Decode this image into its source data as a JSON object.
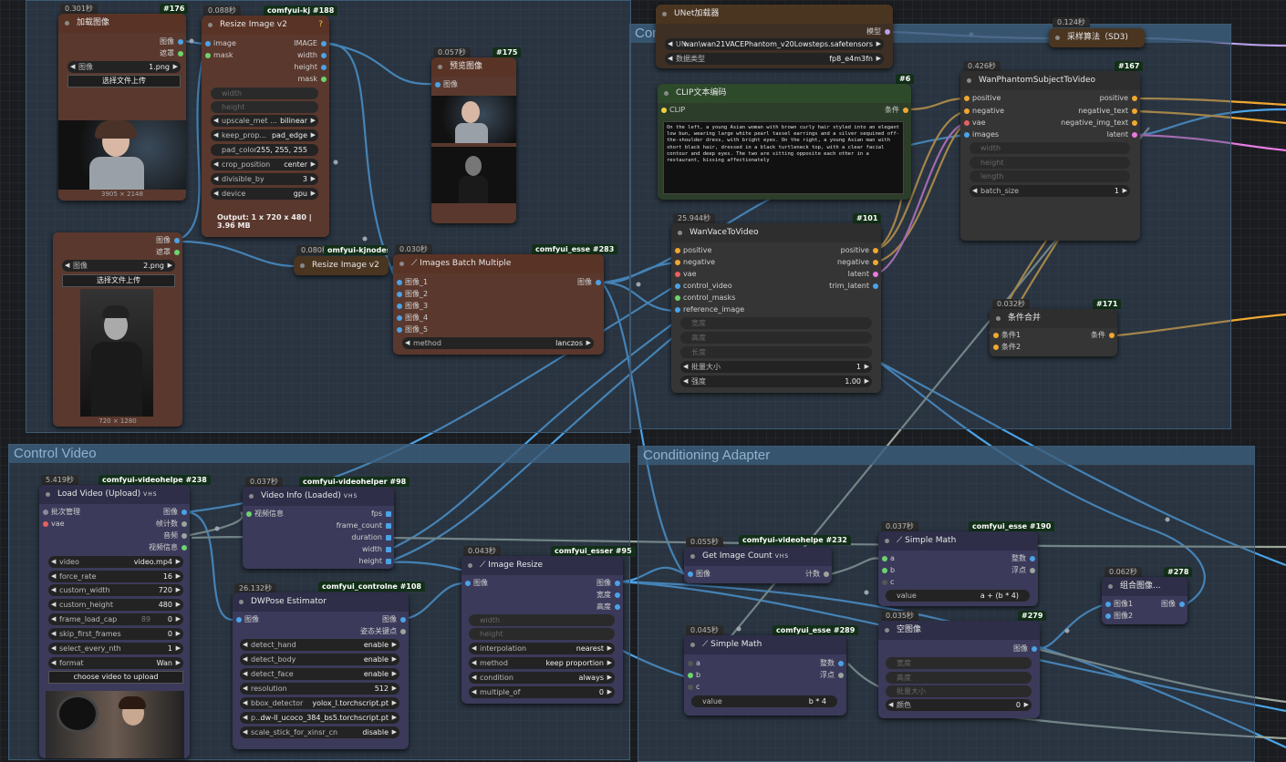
{
  "colors": {
    "link_blue": "#4aa3e8",
    "link_orange": "#f0a830",
    "link_gray": "#9aa69a",
    "link_pink": "#e87ae0",
    "link_lilac": "#b8a0e8",
    "link_red": "#e86060"
  },
  "groups": {
    "top": "Con",
    "control_video": "Control Video",
    "conditioning_adapter": "Conditioning Adapter"
  },
  "n176": {
    "time": "0.301秒",
    "id": "#176",
    "title": "加载图像",
    "out1": "图像",
    "out2": "遮罩",
    "image_label": "图像",
    "image_value": "1.png",
    "upload": "选择文件上传",
    "dims": "3905 × 2148"
  },
  "n188": {
    "time": "0.088秒",
    "badge": "comfyui-kj",
    "id": "#188",
    "title": "Resize Image v2",
    "in1": "image",
    "in2": "mask",
    "out1": "IMAGE",
    "out2": "width",
    "out3": "height",
    "out4": "mask",
    "w_width": "width",
    "w_height": "height",
    "upscale_label": "upscale_met ...",
    "upscale_value": "bilinear",
    "keep_label": "keep_prop...",
    "keep_value": "pad_edge",
    "pad_label": "pad_color",
    "pad_value": "255, 255, 255",
    "crop_label": "crop_position",
    "crop_value": "center",
    "div_label": "divisible_by",
    "div_value": "3",
    "device_label": "device",
    "device_value": "gpu",
    "output": "Output: 1 x 720 x 480 | 3.96 MB"
  },
  "n175": {
    "time": "0.057秒",
    "id": "#175",
    "title": "预览图像",
    "in1": "图像"
  },
  "nload2": {
    "out1": "图像",
    "out2": "遮罩",
    "image_label": "图像",
    "image_value": "2.png",
    "upload": "选择文件上传",
    "dims": "720 × 1280"
  },
  "nresize2": {
    "time": "0.080秒",
    "badge": "omfyui-kjnodes",
    "title": "Resize Image v2"
  },
  "n283": {
    "time": "0.030秒",
    "badge": "comfyui_esse",
    "id": "#283",
    "title": "Images Batch Multiple",
    "in1": "图像_1",
    "in2": "图像_2",
    "in3": "图像_3",
    "in4": "图像_4",
    "in5": "图像_5",
    "out1": "图像",
    "method_label": "method",
    "method_value": "lanczos"
  },
  "nunet": {
    "title": "UNet加载器",
    "out1": "模型",
    "unet_label": "UN...",
    "unet_value": "wan\\wan21VACEPhantom_v20Lowsteps.safetensors",
    "dtype_label": "数据类型",
    "dtype_value": "fp8_e4m3fn"
  },
  "nclip": {
    "id": "#6",
    "title": "CLIP文本编码",
    "in1": "CLIP",
    "out1": "条件",
    "text": "On the left, a young Asian woman with brown curly hair styled into an elegant low bun, wearing large white pearl tassel earrings and a silver sequined off-the-shoulder dress, with bright eyes. On the right, a young Asian man with short black hair, dressed in a black turtleneck top, with a clear facial contour and deep eyes. The two are sitting opposite each other in a restaurant, kissing affectionately"
  },
  "nsampler": {
    "time": "0.124秒",
    "title": "采样算法（SD3)"
  },
  "n167": {
    "time": "0.426秒",
    "id": "#167",
    "title": "WanPhantomSubjectToVideo",
    "in1": "positive",
    "in2": "negative",
    "in3": "vae",
    "in4": "images",
    "out1": "positive",
    "out2": "negative_text",
    "out3": "negative_img_text",
    "out4": "latent",
    "w1": "width",
    "w2": "height",
    "w3": "length",
    "batch_label": "batch_size",
    "batch_value": "1"
  },
  "n101": {
    "time": "25.944秒",
    "id": "#101",
    "title": "WanVaceToVideo",
    "in1": "positive",
    "in2": "negative",
    "in3": "vae",
    "in4": "control_video",
    "in5": "control_masks",
    "in6": "reference_image",
    "out1": "positive",
    "out2": "negative",
    "out3": "latent",
    "out4": "trim_latent",
    "w1": "宽度",
    "w2": "高度",
    "w3": "长度",
    "batch_label": "批量大小",
    "batch_value": "1",
    "strength_label": "强度",
    "strength_value": "1.00"
  },
  "n171": {
    "time": "0.032秒",
    "id": "#171",
    "title": "条件合并",
    "in1": "条件1",
    "in2": "条件2",
    "out1": "条件"
  },
  "n238": {
    "time": "5.419秒",
    "badge": "comfyui-videohelpe",
    "id": "#238",
    "title": "Load Video (Upload)",
    "vhs": "VHS",
    "in1": "批次管理",
    "in2": "vae",
    "out1": "图像",
    "out2": "帧计数",
    "out3": "音频",
    "out4": "视频信息",
    "video_label": "video",
    "video_value": "video.mp4",
    "force_rate_label": "force_rate",
    "force_rate_value": "16",
    "cw_label": "custom_width",
    "cw_value": "720",
    "ch_label": "custom_height",
    "ch_value": "480",
    "flc_label": "frame_load_cap",
    "flc_value": "0",
    "flc_hint": "89",
    "skip_label": "skip_first_frames",
    "skip_value": "0",
    "sel_label": "select_every_nth",
    "sel_value": "1",
    "format_label": "format",
    "format_value": "Wan",
    "upload": "choose video to upload"
  },
  "n98": {
    "time": "0.037秒",
    "badge": "comfyui-videohelper",
    "id": "#98",
    "title": "Video Info (Loaded)",
    "vhs": "VHS",
    "in1": "视频信息",
    "out1": "fps",
    "out2": "frame_count",
    "out3": "duration",
    "out4": "width",
    "out5": "height"
  },
  "n108": {
    "time": "26.132秒",
    "badge": "comfyui_controlne",
    "id": "#108",
    "title": "DWPose Estimator",
    "in1": "图像",
    "out1": "图像",
    "out2": "姿态关键点",
    "hand_label": "detect_hand",
    "hand_value": "enable",
    "body_label": "detect_body",
    "body_value": "enable",
    "face_label": "detect_face",
    "face_value": "enable",
    "res_label": "resolution",
    "res_value": "512",
    "bbox_label": "bbox_detector",
    "bbox_value": "yolox_l.torchscript.pt",
    "pose_label": "p...",
    "pose_value": "dw-ll_ucoco_384_bs5.torchscript.pt",
    "scale_label": "scale_stick_for_xinsr_cn",
    "scale_value": "disable"
  },
  "n95": {
    "time": "0.043秒",
    "badge": "comfyui_esser",
    "id": "#95",
    "title": "Image Resize",
    "in1": "图像",
    "out1": "图像",
    "out2": "宽度",
    "out3": "高度",
    "w1": "width",
    "w2": "height",
    "interp_label": "interpolation",
    "interp_value": "nearest",
    "method_label": "method",
    "method_value": "keep proportion",
    "cond_label": "condition",
    "cond_value": "always",
    "mult_label": "multiple_of",
    "mult_value": "0"
  },
  "n232": {
    "time": "0.055秒",
    "badge": "comfyui-videohelpe",
    "id": "#232",
    "title": "Get Image Count",
    "vhs": "VHS",
    "in1": "图像",
    "out1": "计数"
  },
  "n190": {
    "time": "0.037秒",
    "badge": "comfyui_esse",
    "id": "#190",
    "title": "Simple Math",
    "in1": "a",
    "in2": "b",
    "in3": "c",
    "out1": "整数",
    "out2": "浮点",
    "value_label": "value",
    "value_value": "a + (b * 4)"
  },
  "n289": {
    "time": "0.045秒",
    "badge": "comfyui_esse",
    "id": "#289",
    "title": "Simple Math",
    "in1": "a",
    "in2": "b",
    "in3": "c",
    "out1": "整数",
    "out2": "浮点",
    "value_label": "value",
    "value_value": "b * 4"
  },
  "n279": {
    "time": "0.035秒",
    "id": "#279",
    "title": "空图像",
    "out1": "图像",
    "w1": "宽度",
    "w2": "高度",
    "w3": "批量大小",
    "color_label": "颜色",
    "color_value": "0"
  },
  "n278": {
    "time": "0.062秒",
    "id": "#278",
    "title": "组合图像...",
    "in1": "图像1",
    "in2": "图像2",
    "out1": "图像"
  }
}
